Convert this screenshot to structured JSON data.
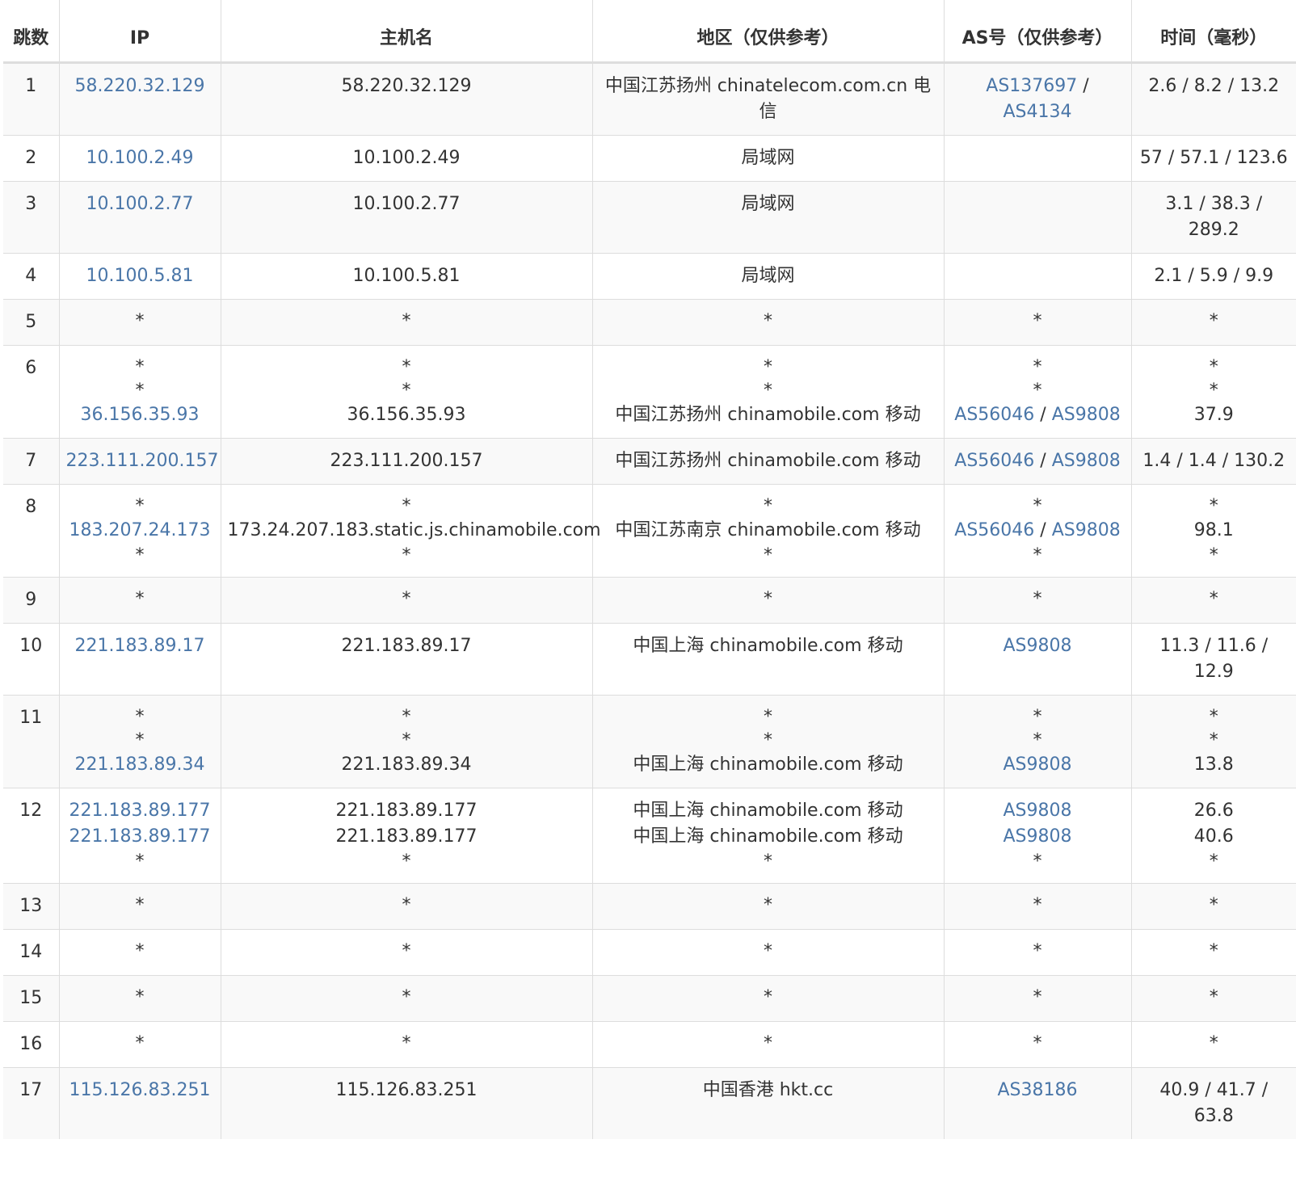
{
  "headers": {
    "hop": "跳数",
    "ip": "IP",
    "hostname": "主机名",
    "region": "地区（仅供参考）",
    "asn": "AS号（仅供参考）",
    "time": "时间（毫秒）"
  },
  "rows": [
    {
      "hop": "1",
      "ip": [
        "58.220.32.129"
      ],
      "host": [
        "58.220.32.129"
      ],
      "region": [
        "中国江苏扬州 chinatelecom.com.cn 电信"
      ],
      "asn": [
        [
          "AS137697",
          "AS4134"
        ]
      ],
      "time": [
        "2.6 / 8.2 / 13.2"
      ]
    },
    {
      "hop": "2",
      "ip": [
        "10.100.2.49"
      ],
      "host": [
        "10.100.2.49"
      ],
      "region": [
        "局域网"
      ],
      "asn": [
        []
      ],
      "time": [
        "57 / 57.1 / 123.6"
      ]
    },
    {
      "hop": "3",
      "ip": [
        "10.100.2.77"
      ],
      "host": [
        "10.100.2.77"
      ],
      "region": [
        "局域网"
      ],
      "asn": [
        []
      ],
      "time": [
        "3.1 / 38.3 / 289.2"
      ]
    },
    {
      "hop": "4",
      "ip": [
        "10.100.5.81"
      ],
      "host": [
        "10.100.5.81"
      ],
      "region": [
        "局域网"
      ],
      "asn": [
        []
      ],
      "time": [
        "2.1 / 5.9 / 9.9"
      ]
    },
    {
      "hop": "5",
      "ip": [
        "*"
      ],
      "host": [
        "*"
      ],
      "region": [
        "*"
      ],
      "asn": [
        [
          "*"
        ]
      ],
      "time": [
        "*"
      ]
    },
    {
      "hop": "6",
      "ip": [
        "*",
        "*",
        "36.156.35.93"
      ],
      "host": [
        "*",
        "*",
        "36.156.35.93"
      ],
      "region": [
        "*",
        "*",
        "中国江苏扬州 chinamobile.com 移动"
      ],
      "asn": [
        [
          "*"
        ],
        [
          "*"
        ],
        [
          "AS56046",
          "AS9808"
        ]
      ],
      "time": [
        "*",
        "*",
        "37.9"
      ]
    },
    {
      "hop": "7",
      "ip": [
        "223.111.200.157"
      ],
      "host": [
        "223.111.200.157"
      ],
      "region": [
        "中国江苏扬州 chinamobile.com 移动"
      ],
      "asn": [
        [
          "AS56046",
          "AS9808"
        ]
      ],
      "time": [
        "1.4 / 1.4 / 130.2"
      ]
    },
    {
      "hop": "8",
      "ip": [
        "*",
        "183.207.24.173",
        "*"
      ],
      "host": [
        "*",
        "173.24.207.183.static.js.chinamobile.com",
        "*"
      ],
      "region": [
        "*",
        "中国江苏南京 chinamobile.com 移动",
        "*"
      ],
      "asn": [
        [
          "*"
        ],
        [
          "AS56046",
          "AS9808"
        ],
        [
          "*"
        ]
      ],
      "time": [
        "*",
        "98.1",
        "*"
      ]
    },
    {
      "hop": "9",
      "ip": [
        "*"
      ],
      "host": [
        "*"
      ],
      "region": [
        "*"
      ],
      "asn": [
        [
          "*"
        ]
      ],
      "time": [
        "*"
      ]
    },
    {
      "hop": "10",
      "ip": [
        "221.183.89.17"
      ],
      "host": [
        "221.183.89.17"
      ],
      "region": [
        "中国上海 chinamobile.com 移动"
      ],
      "asn": [
        [
          "AS9808"
        ]
      ],
      "time": [
        "11.3 / 11.6 / 12.9"
      ]
    },
    {
      "hop": "11",
      "ip": [
        "*",
        "*",
        "221.183.89.34"
      ],
      "host": [
        "*",
        "*",
        "221.183.89.34"
      ],
      "region": [
        "*",
        "*",
        "中国上海 chinamobile.com 移动"
      ],
      "asn": [
        [
          "*"
        ],
        [
          "*"
        ],
        [
          "AS9808"
        ]
      ],
      "time": [
        "*",
        "*",
        "13.8"
      ]
    },
    {
      "hop": "12",
      "ip": [
        "221.183.89.177",
        "221.183.89.177",
        "*"
      ],
      "host": [
        "221.183.89.177",
        "221.183.89.177",
        "*"
      ],
      "region": [
        "中国上海 chinamobile.com 移动",
        "中国上海 chinamobile.com 移动",
        "*"
      ],
      "asn": [
        [
          "AS9808"
        ],
        [
          "AS9808"
        ],
        [
          "*"
        ]
      ],
      "time": [
        "26.6",
        "40.6",
        "*"
      ]
    },
    {
      "hop": "13",
      "ip": [
        "*"
      ],
      "host": [
        "*"
      ],
      "region": [
        "*"
      ],
      "asn": [
        [
          "*"
        ]
      ],
      "time": [
        "*"
      ]
    },
    {
      "hop": "14",
      "ip": [
        "*"
      ],
      "host": [
        "*"
      ],
      "region": [
        "*"
      ],
      "asn": [
        [
          "*"
        ]
      ],
      "time": [
        "*"
      ]
    },
    {
      "hop": "15",
      "ip": [
        "*"
      ],
      "host": [
        "*"
      ],
      "region": [
        "*"
      ],
      "asn": [
        [
          "*"
        ]
      ],
      "time": [
        "*"
      ]
    },
    {
      "hop": "16",
      "ip": [
        "*"
      ],
      "host": [
        "*"
      ],
      "region": [
        "*"
      ],
      "asn": [
        [
          "*"
        ]
      ],
      "time": [
        "*"
      ]
    },
    {
      "hop": "17",
      "ip": [
        "115.126.83.251"
      ],
      "host": [
        "115.126.83.251"
      ],
      "region": [
        "中国香港 hkt.cc"
      ],
      "asn": [
        [
          "AS38186"
        ]
      ],
      "time": [
        "40.9 / 41.7 / 63.8"
      ]
    }
  ]
}
